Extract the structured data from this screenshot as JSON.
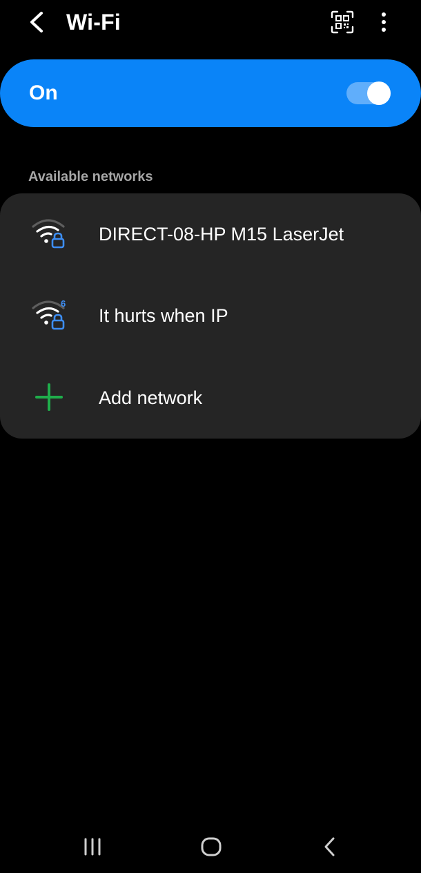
{
  "app_bar": {
    "title": "Wi-Fi",
    "back_icon": "chevron-left-icon",
    "qr_icon": "qr-code-scan-icon",
    "more_icon": "more-vertical-icon"
  },
  "master_switch": {
    "label": "On",
    "checked": true,
    "accent_color": "#0a84f8"
  },
  "available_networks": {
    "header": "Available networks",
    "items": [
      {
        "name": "DIRECT-08-HP M15 LaserJet",
        "icon": "wifi-secured-icon",
        "secured": true
      },
      {
        "name": "It hurts when IP",
        "icon": "wifi-6-secured-icon",
        "secured": true
      },
      {
        "name": "Add network",
        "icon": "plus-icon"
      }
    ]
  },
  "nav_bar": {
    "recents_icon": "recents-icon",
    "home_icon": "home-icon",
    "back_icon": "back-icon"
  }
}
